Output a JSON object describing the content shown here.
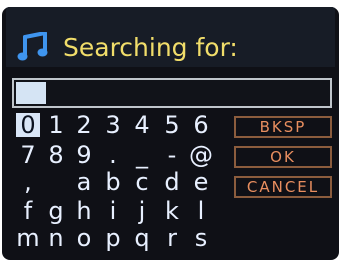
{
  "header": {
    "title": "Searching for:"
  },
  "search": {
    "value": ""
  },
  "keyboard": {
    "rows": [
      [
        "0",
        "1",
        "2",
        "3",
        "4",
        "5",
        "6"
      ],
      [
        "7",
        "8",
        "9",
        ".",
        "_",
        "-",
        "@"
      ],
      [
        ",",
        "a",
        "b",
        "c",
        "d",
        "e"
      ],
      [
        "f",
        "g",
        "h",
        "i",
        "j",
        "k",
        "l"
      ],
      [
        "m",
        "n",
        "o",
        "p",
        "q",
        "r",
        "s"
      ]
    ],
    "selected_key": "0"
  },
  "buttons": {
    "backspace": "BKSP",
    "ok": "OK",
    "cancel": "CANCEL"
  },
  "colors": {
    "title": "#f1dd6a",
    "button_text": "#e88e5f",
    "button_border": "#8b5c3d",
    "key_text": "#e8f0ff",
    "selection": "#d9e6f7",
    "music_icon": "#3f95ef"
  },
  "icons": {
    "header": "music-note-icon"
  }
}
